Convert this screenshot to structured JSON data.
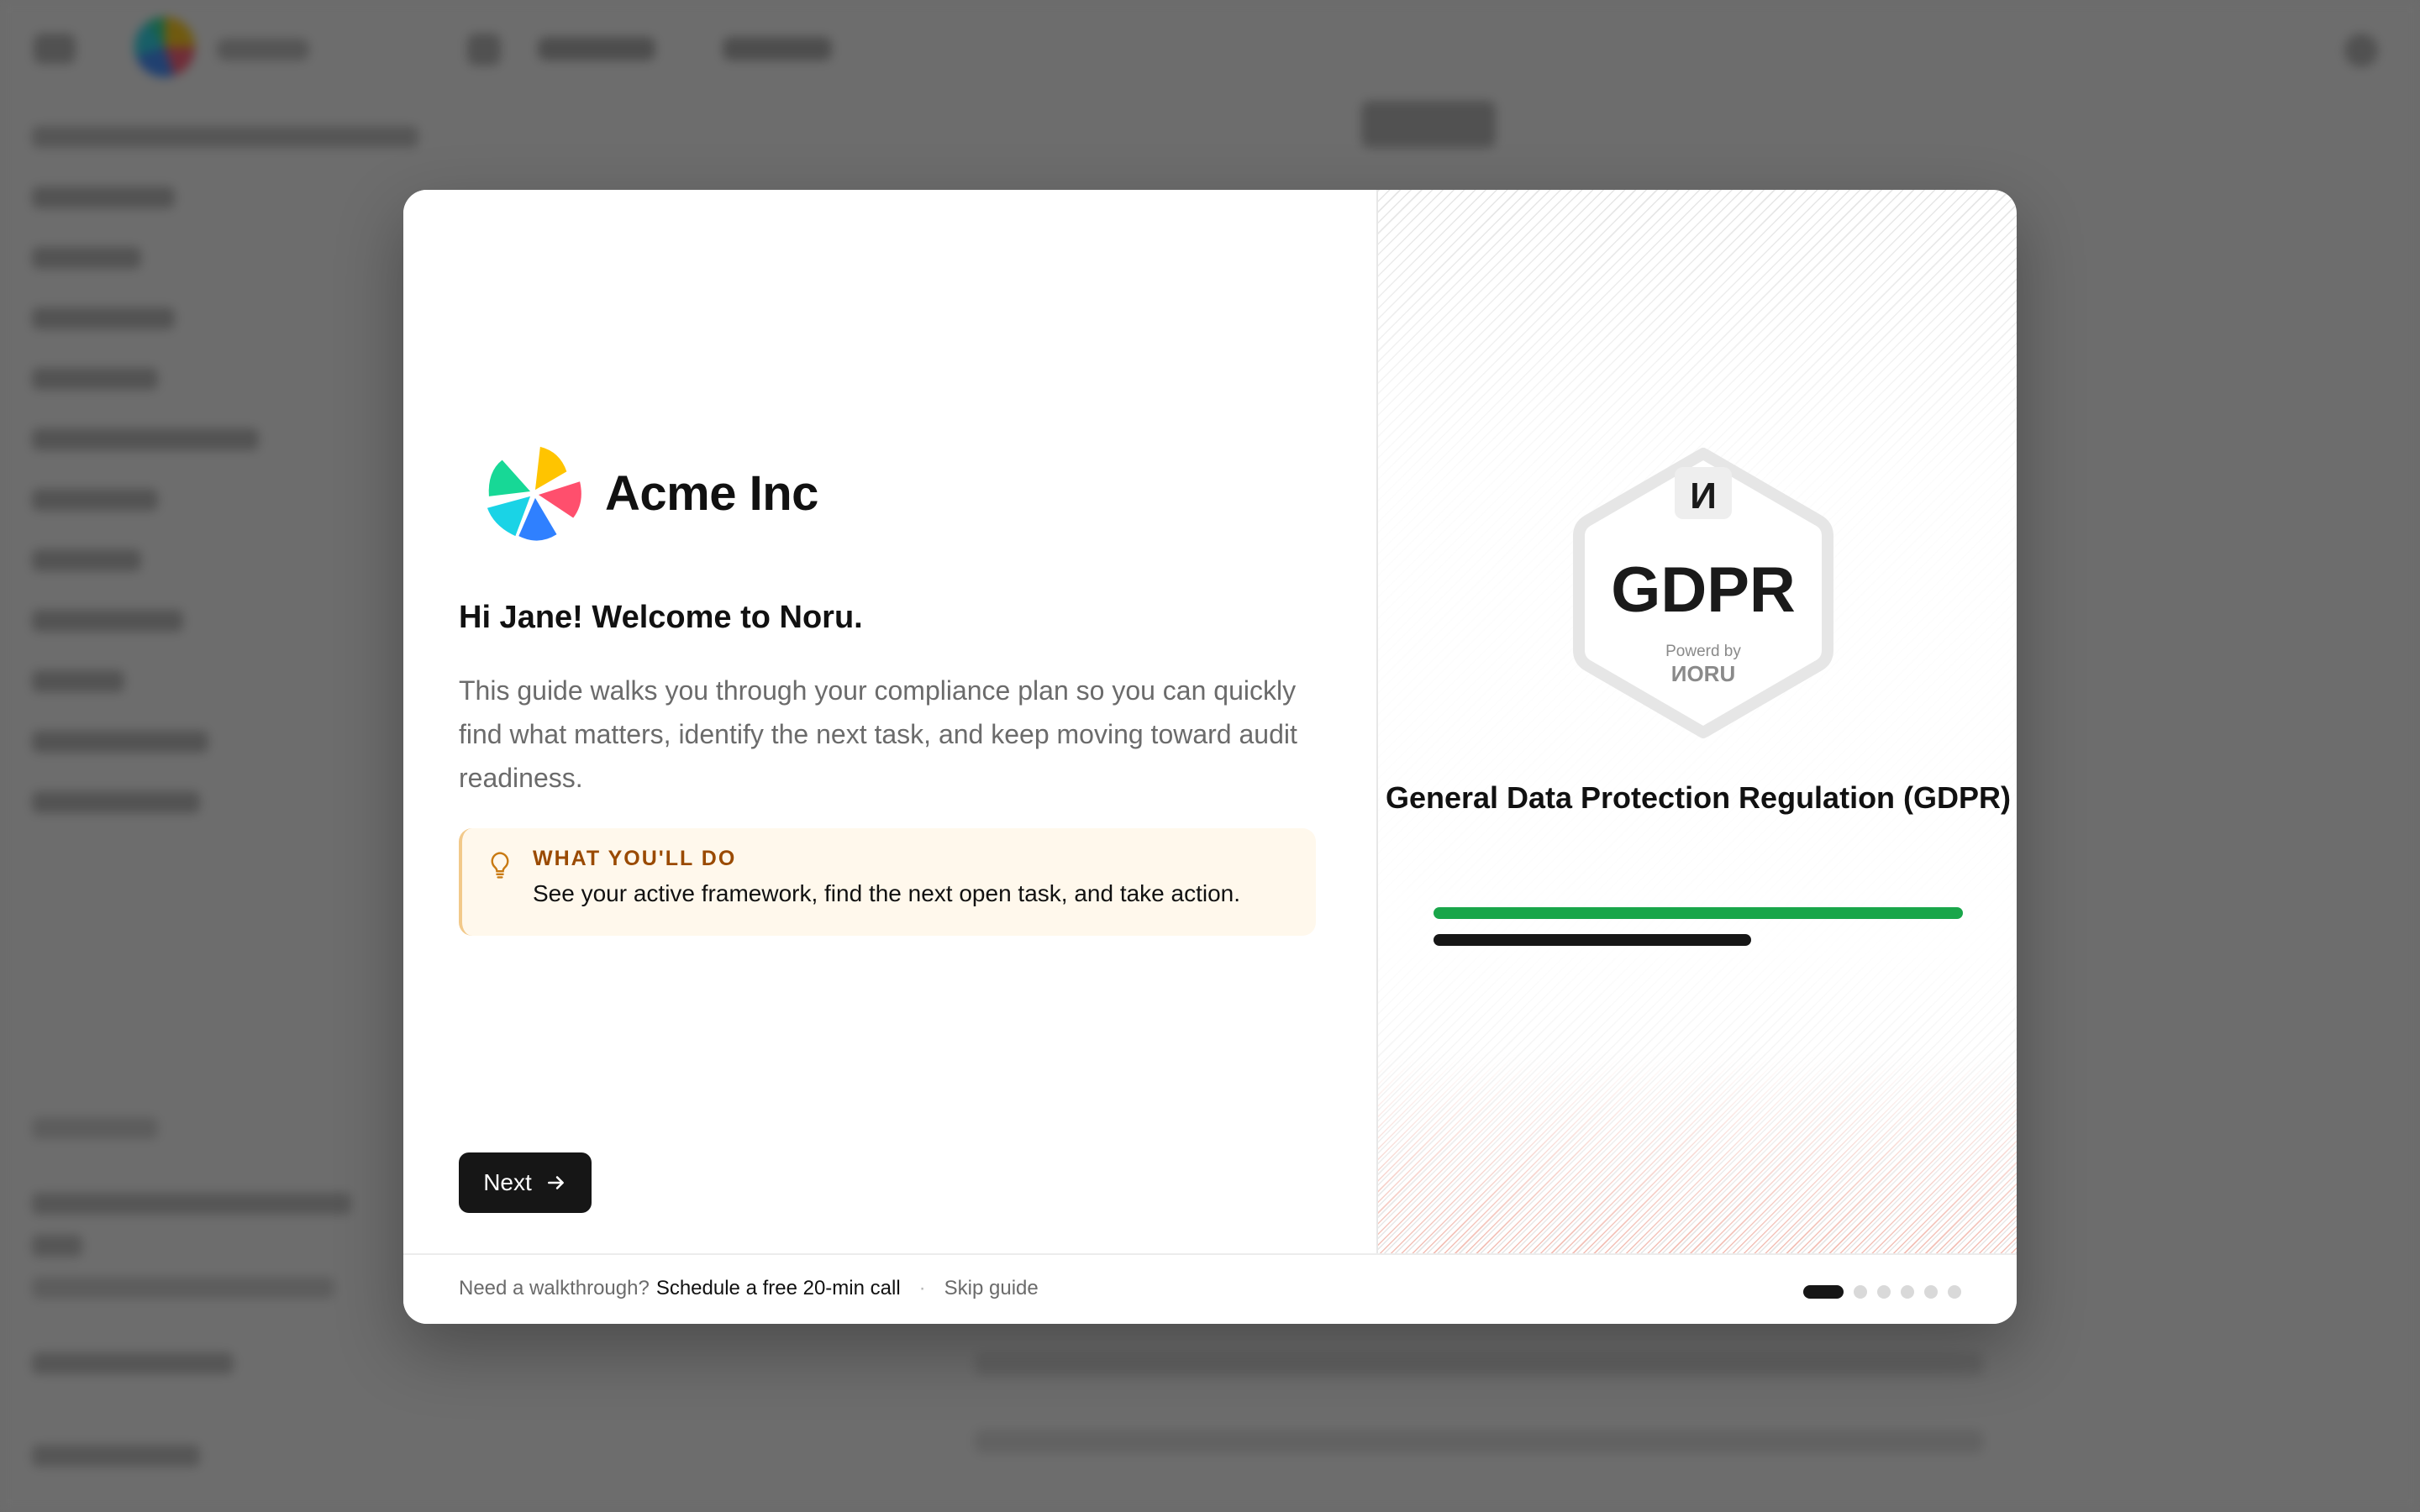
{
  "company": {
    "name": "Acme Inc"
  },
  "welcome": {
    "heading": "Hi Jane! Welcome to Noru.",
    "body": "This guide walks you through your compliance plan so you can quickly find what matters, identify the next task, and keep moving toward audit readiness."
  },
  "tip": {
    "title": "WHAT YOU'LL DO",
    "body": "See your active framework, find the next open task, and take action.",
    "icon": "lightbulb-icon",
    "accent": "#9a4a00"
  },
  "next_button": {
    "label": "Next",
    "icon": "arrow-right-icon"
  },
  "footer": {
    "prompt": "Need a walkthrough?",
    "schedule_link": "Schedule a free 20-min call",
    "separator": "·",
    "skip_link": "Skip guide",
    "steps_total": 6,
    "steps_current": 1
  },
  "framework": {
    "badge_monogram": "И",
    "badge_label": "GDPR",
    "powered_by": "Powerd by",
    "powered_brand": "ИORU",
    "title": "General Data Protection Regulation (GDPR)",
    "progress_colors": {
      "complete": "#19a64a",
      "secondary": "#161616"
    }
  }
}
